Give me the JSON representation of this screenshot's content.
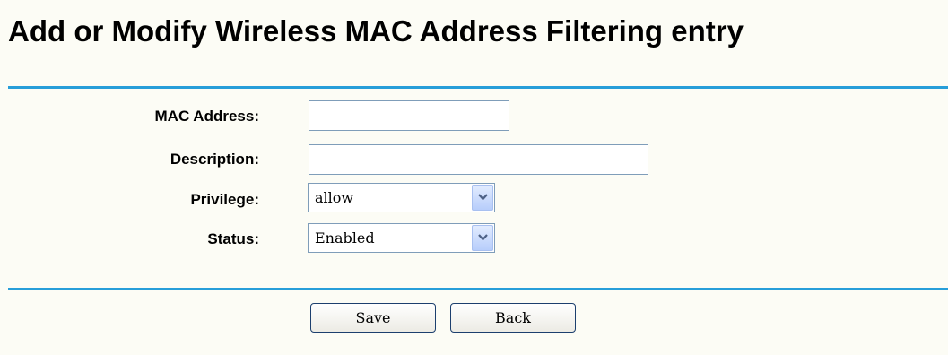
{
  "page": {
    "title": "Add or Modify Wireless MAC Address Filtering entry"
  },
  "form": {
    "mac_label": "MAC Address:",
    "mac_value": "",
    "description_label": "Description:",
    "description_value": "",
    "privilege_label": "Privilege:",
    "privilege_value": "allow",
    "status_label": "Status:",
    "status_value": "Enabled"
  },
  "buttons": {
    "save": "Save",
    "back": "Back"
  },
  "colors": {
    "rule": "#279ed9",
    "background": "#fcfcf5",
    "field_border": "#7f9db9"
  },
  "icons": {
    "dropdown": "chevron-down-icon"
  }
}
